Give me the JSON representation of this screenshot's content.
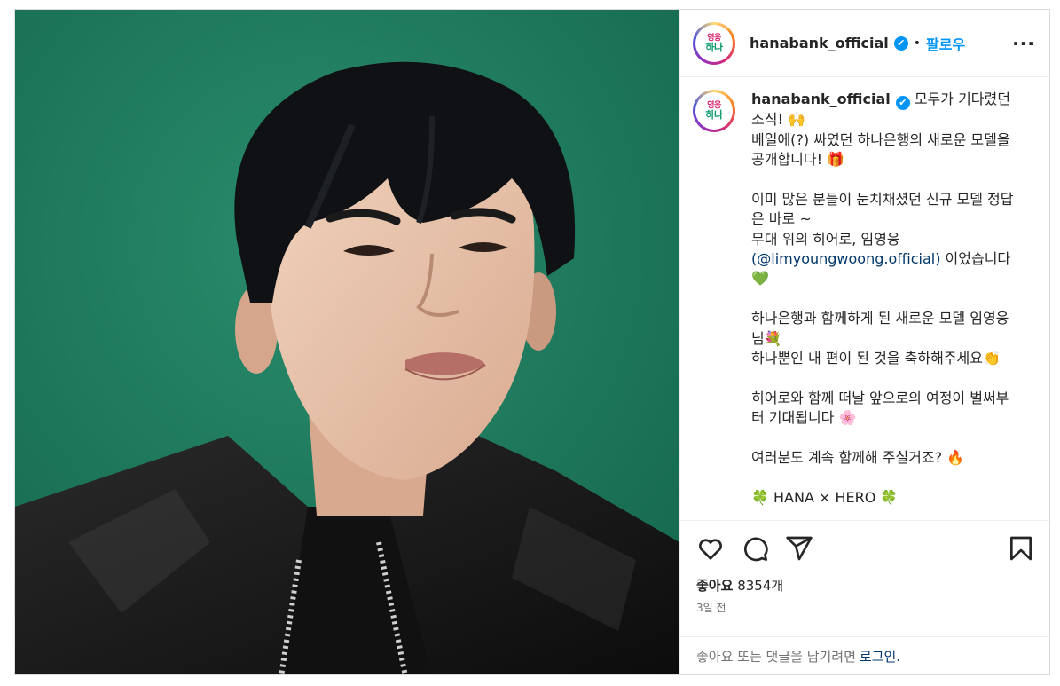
{
  "header": {
    "username": "hanabank_official",
    "verified_mark": "✔",
    "separator": "•",
    "follow_label": "팔로우",
    "more_label": "···",
    "avatar_top": "영웅",
    "avatar_bottom": "하나"
  },
  "caption": {
    "username": "hanabank_official",
    "line1": " 모두가 기다렸던 소식! 🙌",
    "line2": "베일에(?) 싸였던 하나은행의 새로운 모델을 공개합니다! 🎁",
    "line3": "이미 많은 분들이 눈치채셨던 신규 모델 정답은 바로 ~",
    "line4": "무대 위의 히어로, 임영웅",
    "mention": "(@limyoungwoong.official)",
    "line5": " 이었습니다 💚",
    "line6": "하나은행과 함께하게 된 새로운 모델 임영웅님💐",
    "line7": "하나뿐인 내 편이 된 것을 축하해주세요👏",
    "line8": "히어로와 함께 떠날 앞으로의 여정이 벌써부터 기대됩니다 🌸",
    "line9": "여러분도 계속 함께해 주실거죠? 🔥",
    "line10": "🍀 HANA × HERO 🍀"
  },
  "actions": {
    "like_icon": "heart-icon",
    "comment_icon": "comment-icon",
    "share_icon": "send-icon",
    "save_icon": "bookmark-icon"
  },
  "likes": {
    "label": "좋아요",
    "count": "8354개"
  },
  "time_ago": "3일 전",
  "login_prompt": {
    "text": "좋아요 또는 댓글을 남기려면",
    "link": "로그인."
  },
  "colors": {
    "accent": "#0095f6",
    "background_green": "#1f7d60",
    "mention": "#00376b"
  }
}
